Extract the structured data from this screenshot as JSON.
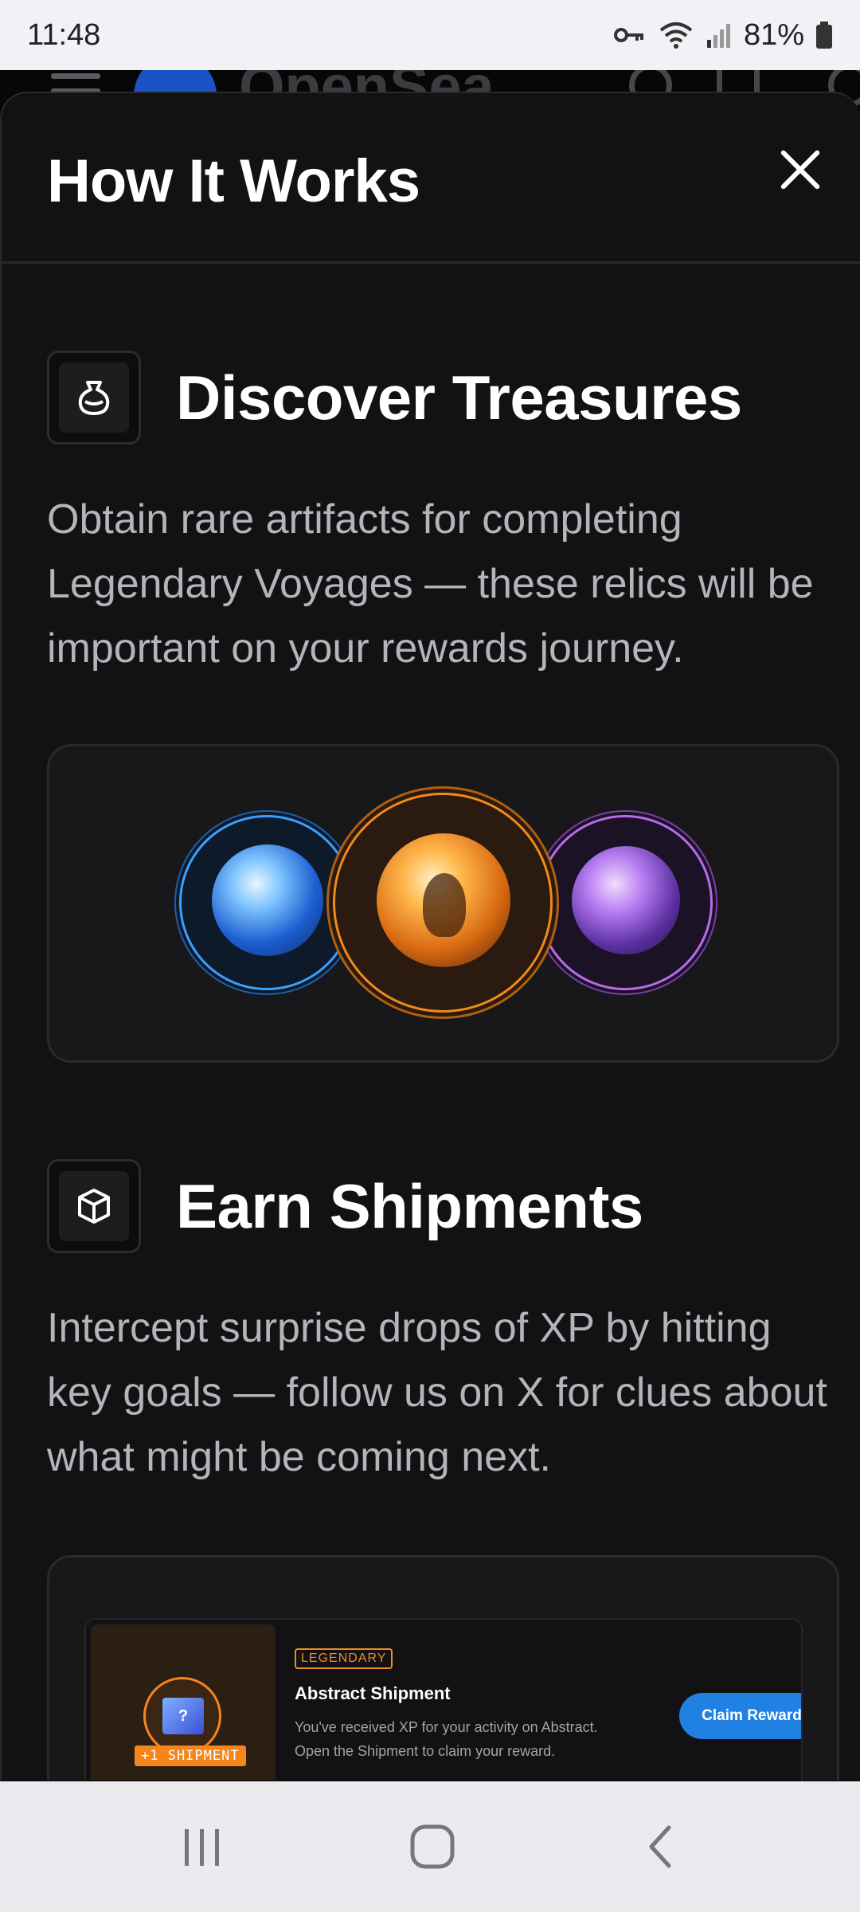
{
  "status_bar": {
    "time": "11:48",
    "battery": "81%"
  },
  "background_app": {
    "brand": "OpenSea"
  },
  "sheet": {
    "title": "How It Works"
  },
  "sections": [
    {
      "title": "Discover Treasures",
      "icon": "potion-bag-icon",
      "description": "Obtain rare artifacts for completing Legendary Voyages — these relics will be important on your rewards journey."
    },
    {
      "title": "Earn Shipments",
      "icon": "cube-icon",
      "description": "Intercept surprise drops of XP by hitting key goals — follow us on X for clues about what might be coming next."
    }
  ],
  "relics": [
    {
      "name": "water-relic",
      "color": "#3aa0ff"
    },
    {
      "name": "fire-relic",
      "color": "#f28a1c"
    },
    {
      "name": "void-relic",
      "color": "#b86be8"
    }
  ],
  "shipment_preview": {
    "badge": "+1 SHIPMENT",
    "tag": "LEGENDARY",
    "title": "Abstract Shipment",
    "description": "You've received XP for your activity on Abstract. Open the Shipment to claim your reward.",
    "button": "Claim Reward"
  },
  "colors": {
    "accent_blue": "#2081e2",
    "legendary_orange": "#f6851b",
    "sheet_bg": "#121214"
  }
}
